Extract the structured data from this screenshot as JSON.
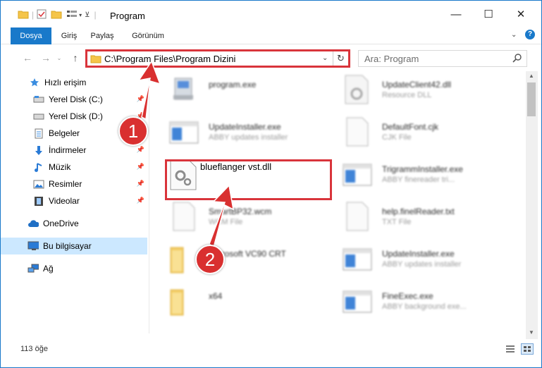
{
  "window": {
    "title": "Program"
  },
  "window_controls": {
    "minimize": "—",
    "maximize": "☐",
    "close": "✕"
  },
  "ribbon": {
    "tabs": [
      {
        "label": "Dosya",
        "active": true
      },
      {
        "label": "Giriş"
      },
      {
        "label": "Paylaş"
      },
      {
        "label": "Görünüm"
      }
    ]
  },
  "address": {
    "path": "C:\\Program Files\\Program Dizini"
  },
  "search": {
    "placeholder": "Ara: Program"
  },
  "sidebar": {
    "items": [
      {
        "label": "Hızlı erişim"
      },
      {
        "label": "Yerel Disk (C:)"
      },
      {
        "label": "Yerel Disk (D:)"
      },
      {
        "label": "Belgeler"
      },
      {
        "label": "İndirmeler"
      },
      {
        "label": "Müzik"
      },
      {
        "label": "Resimler"
      },
      {
        "label": "Videolar"
      },
      {
        "label": "OneDrive"
      },
      {
        "label": "Bu bilgisayar",
        "selected": true
      },
      {
        "label": "Ağ"
      }
    ]
  },
  "files": [
    {
      "name": "program.exe",
      "desc": ""
    },
    {
      "name": "UpdateClient42.dll",
      "desc": "Resource DLL"
    },
    {
      "name": "UpdateInstaller.exe",
      "desc": "ABBY updates installer"
    },
    {
      "name": "DefaultFont.cjk",
      "desc": "CJK File"
    },
    {
      "name": "blueflanger vst.dll",
      "desc": ""
    },
    {
      "name": "TrigrammInstaller.exe",
      "desc": "ABBY finereader tri..."
    },
    {
      "name": "SmartBP32.wcm",
      "desc": "WCM File"
    },
    {
      "name": "help.finelReader.txt",
      "desc": "TXT File"
    },
    {
      "name": "Microsoft VC90 CRT",
      "desc": ""
    },
    {
      "name": "UpdateInstaller.exe",
      "desc": "ABBY updates installer"
    },
    {
      "name": "x64",
      "desc": ""
    },
    {
      "name": "FineExec.exe",
      "desc": "ABBY background exe..."
    }
  ],
  "status": {
    "count": "113 öğe"
  },
  "annotations": {
    "step1": "1",
    "step2": "2"
  },
  "colors": {
    "accent": "#1979ca",
    "highlight": "#d9343b",
    "badge": "#d93030"
  }
}
